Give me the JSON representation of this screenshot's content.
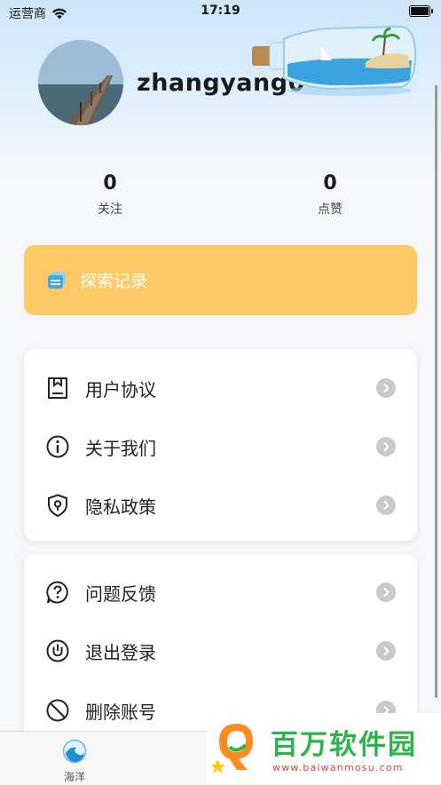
{
  "status_bar": {
    "carrier": "运营商",
    "time": "17:19"
  },
  "profile": {
    "username": "zhangyang0"
  },
  "stats": [
    {
      "value": "0",
      "label": "关注"
    },
    {
      "value": "0",
      "label": "点赞"
    }
  ],
  "explore": {
    "label": "探索记录"
  },
  "menu_group_1": [
    {
      "label": "用户协议",
      "icon": "document-icon"
    },
    {
      "label": "关于我们",
      "icon": "info-icon"
    },
    {
      "label": "隐私政策",
      "icon": "shield-icon"
    }
  ],
  "menu_group_2": [
    {
      "label": "问题反馈",
      "icon": "question-icon"
    },
    {
      "label": "退出登录",
      "icon": "power-icon"
    },
    {
      "label": "删除账号",
      "icon": "ban-icon"
    }
  ],
  "tabbar": {
    "tab_label": "海洋"
  },
  "watermark": {
    "name": "百万软件园",
    "url": "www.baiwanmosu.com"
  },
  "colors": {
    "explore_bg": "#ffc966",
    "watermark_green": "#2eb34a",
    "watermark_red": "#e0403a"
  }
}
